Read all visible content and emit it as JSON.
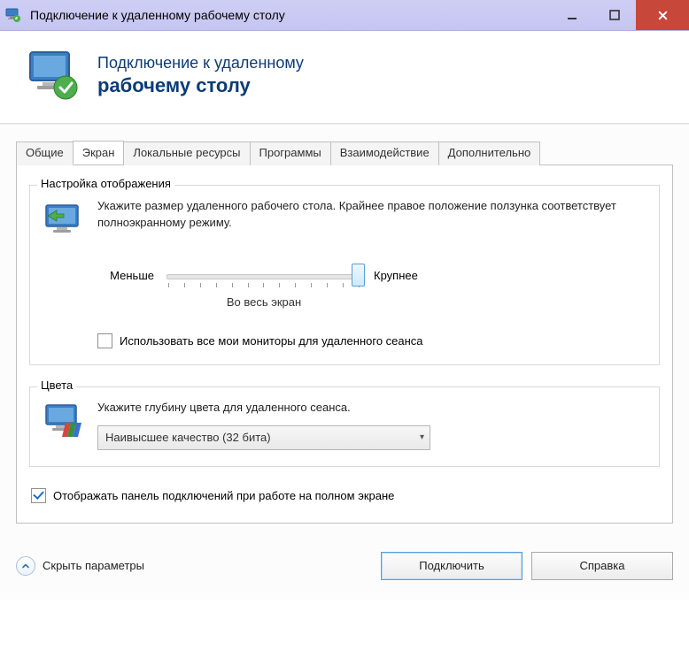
{
  "window": {
    "title": "Подключение к удаленному рабочему столу"
  },
  "header": {
    "line1": "Подключение к удаленному",
    "line2": "рабочему столу"
  },
  "tabs": {
    "general": "Общие",
    "display": "Экран",
    "local": "Локальные ресурсы",
    "programs": "Программы",
    "experience": "Взаимодействие",
    "advanced": "Дополнительно"
  },
  "display_group": {
    "legend": "Настройка отображения",
    "desc": "Укажите размер удаленного рабочего стола. Крайнее правое положение ползунка соответствует полноэкранному режиму.",
    "smaller": "Меньше",
    "larger": "Крупнее",
    "value_label": "Во весь экран",
    "use_all_monitors": "Использовать все мои мониторы для удаленного сеанса"
  },
  "colors_group": {
    "legend": "Цвета",
    "desc": "Укажите глубину цвета для удаленного сеанса.",
    "selected": "Наивысшее качество (32 бита)"
  },
  "show_connection_bar": "Отображать панель подключений при работе на полном экране",
  "footer": {
    "hide": "Скрыть параметры",
    "connect": "Подключить",
    "help": "Справка"
  }
}
